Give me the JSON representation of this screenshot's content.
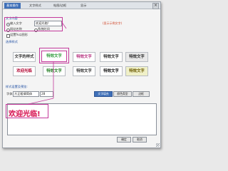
{
  "tabs": [
    {
      "label": "基本操作",
      "active": true
    },
    {
      "label": "文字样式",
      "active": false
    },
    {
      "label": "帖图/边框",
      "active": false
    },
    {
      "label": "显示",
      "active": false
    }
  ],
  "text_content": {
    "section_title": "文字内容",
    "option_input_label": "输入文字",
    "input_value": "欢迎光临!",
    "browse_link": "(显示示例文字)",
    "option_web_label": "网站名称",
    "option_time_label": "系统时间",
    "show_sample_label": "设置%以图形"
  },
  "samples": {
    "section_title": "选择样式",
    "items": [
      {
        "text": "文字的样式",
        "color": "#333333",
        "bg": "#ffffff",
        "selected": false
      },
      {
        "text": "特效文字",
        "color": "#2f9a3a",
        "bg": "#ffffff",
        "selected": true
      },
      {
        "text": "特效文字",
        "color": "#b52e7d",
        "bg": "#ffffff",
        "selected": false
      },
      {
        "text": "特效文字",
        "color": "#2a2a2a",
        "bg": "#ffffff",
        "selected": false
      },
      {
        "text": "特效文字",
        "color": "#2a2a2a",
        "bg": "#e8e8e8",
        "selected": false
      },
      {
        "text": "欢迎光临",
        "color": "#b0002e",
        "bg": "#ffffff",
        "selected": false
      },
      {
        "text": "特效文字",
        "color": "#1e7a1e",
        "bg": "#ffffff",
        "selected": false
      },
      {
        "text": "特效文字",
        "color": "#333333",
        "bg": "#ffffff",
        "selected": false
      },
      {
        "text": "特效文字",
        "color": "#111111",
        "bg": "#ffffff",
        "selected": false
      },
      {
        "text": "特效文字",
        "color": "#6b5a00",
        "bg": "#f0f0c8",
        "selected": false
      }
    ]
  },
  "preview": {
    "section_title": "样式设置及预览:",
    "font_label": "字体:",
    "font_value": "方正粗倩简体",
    "size_value": "28",
    "btn_text_effect": "文字填充",
    "btn_text_color": "颜色类型",
    "btn_border": "边框",
    "preview_text": "欢迎光临!",
    "preview_color": "#d81f5b"
  },
  "footer": {
    "ok_label": "确定",
    "cancel_label": "取消"
  }
}
